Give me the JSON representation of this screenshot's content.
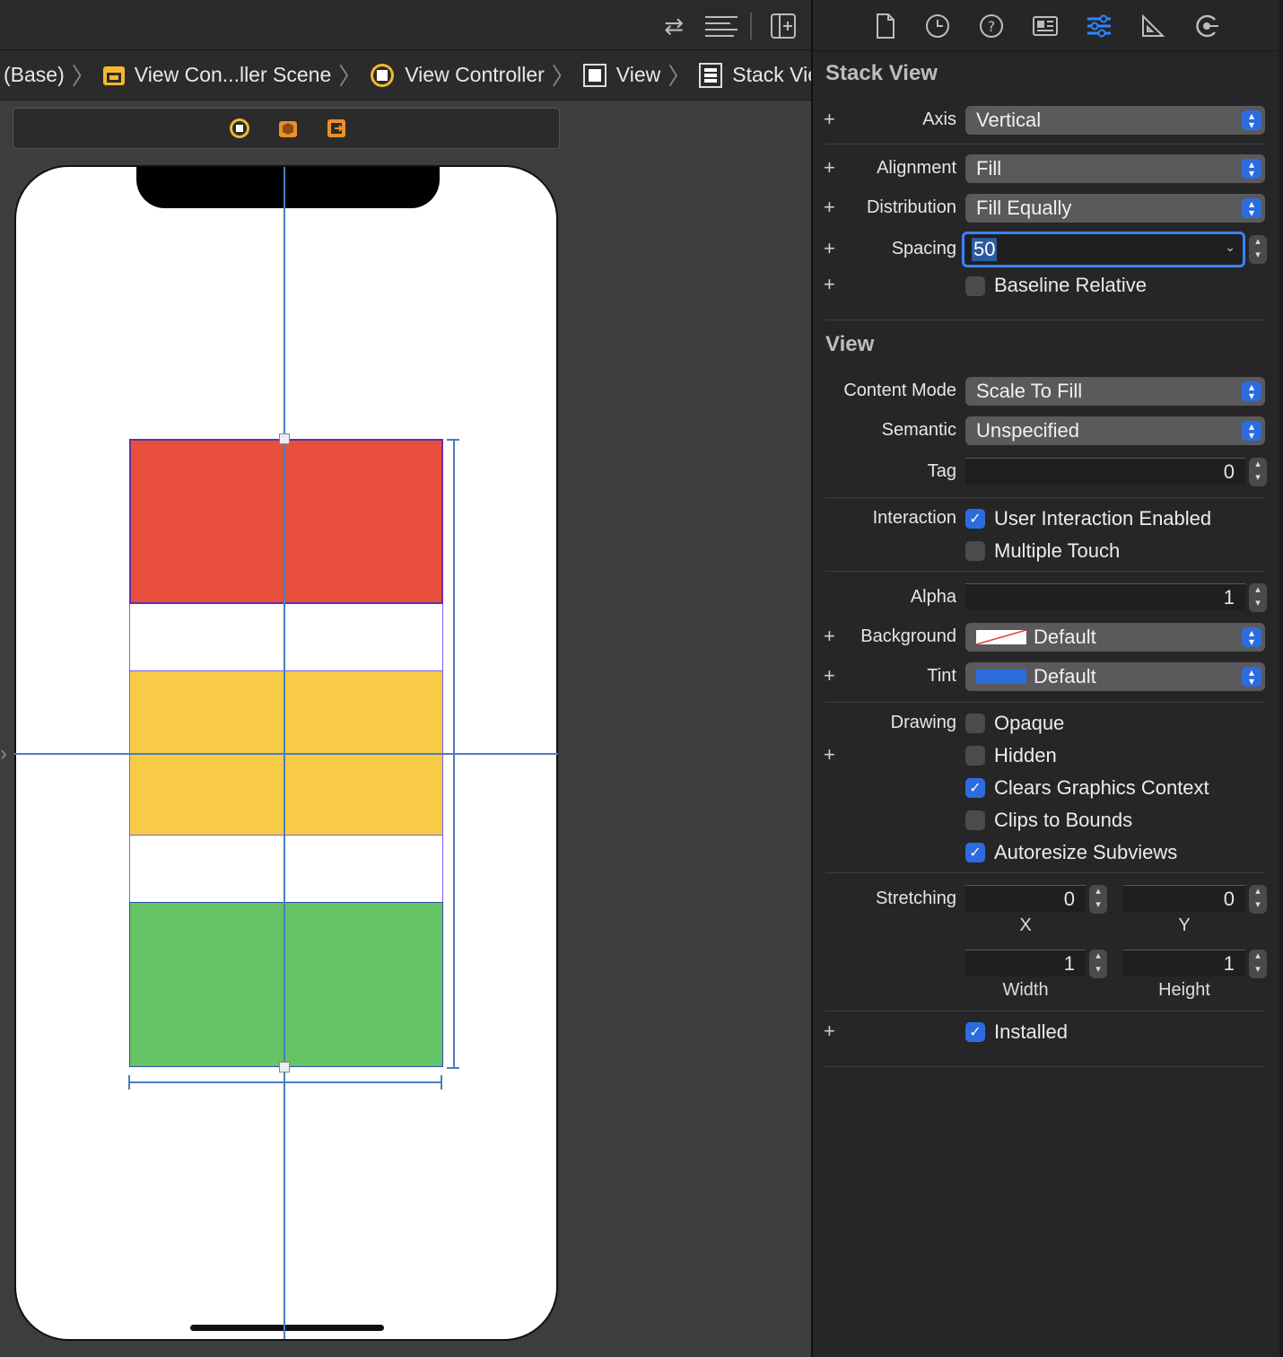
{
  "breadcrumb": {
    "items": [
      "(Base)",
      "View Con...ller Scene",
      "View Controller",
      "View",
      "Stack View"
    ]
  },
  "canvas": {
    "stack_colors": {
      "red": "#e94f3d",
      "yellow": "#f7cb45",
      "green": "#64c466"
    }
  },
  "inspector": {
    "stack_view": {
      "title": "Stack View",
      "axis_label": "Axis",
      "axis_value": "Vertical",
      "alignment_label": "Alignment",
      "alignment_value": "Fill",
      "distribution_label": "Distribution",
      "distribution_value": "Fill Equally",
      "spacing_label": "Spacing",
      "spacing_value": "50",
      "baseline_label": "Baseline Relative",
      "baseline_checked": false
    },
    "view": {
      "title": "View",
      "content_mode_label": "Content Mode",
      "content_mode_value": "Scale To Fill",
      "semantic_label": "Semantic",
      "semantic_value": "Unspecified",
      "tag_label": "Tag",
      "tag_value": "0",
      "interaction_label": "Interaction",
      "user_interaction_label": "User Interaction Enabled",
      "multiple_touch_label": "Multiple Touch",
      "alpha_label": "Alpha",
      "alpha_value": "1",
      "background_label": "Background",
      "background_value": "Default",
      "tint_label": "Tint",
      "tint_value": "Default",
      "tint_color": "#2d6cdf",
      "drawing_label": "Drawing",
      "opaque_label": "Opaque",
      "hidden_label": "Hidden",
      "clears_label": "Clears Graphics Context",
      "clips_label": "Clips to Bounds",
      "autoresize_label": "Autoresize Subviews",
      "stretching_label": "Stretching",
      "stretch_x": "0",
      "stretch_y": "0",
      "stretch_w": "1",
      "stretch_h": "1",
      "x_label": "X",
      "y_label": "Y",
      "width_label": "Width",
      "height_label": "Height",
      "installed_label": "Installed"
    }
  }
}
